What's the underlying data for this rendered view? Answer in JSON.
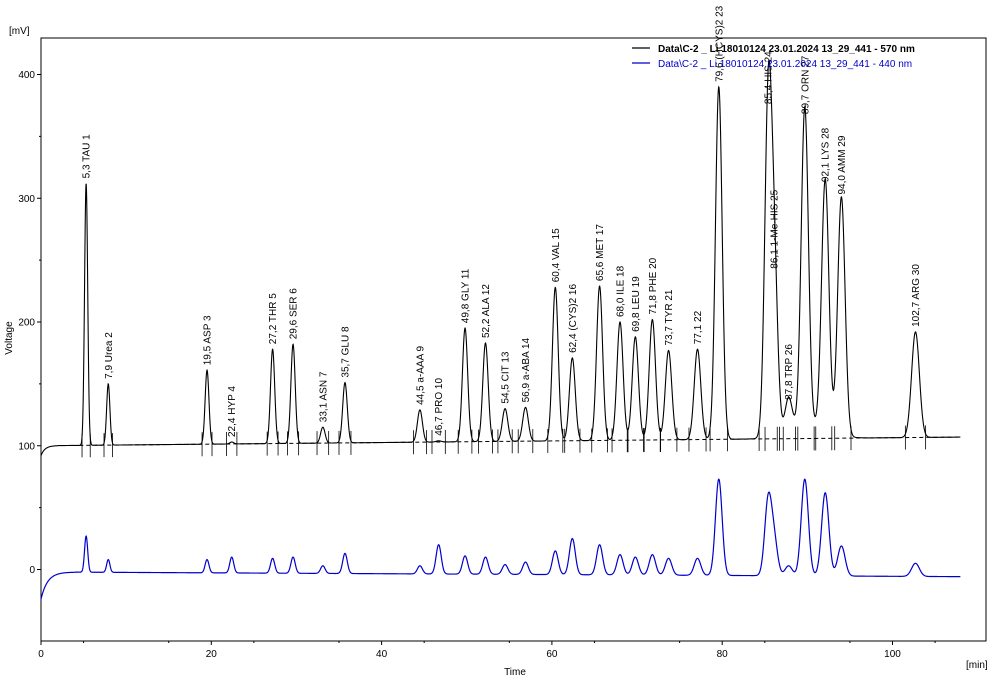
{
  "chart_data": {
    "type": "line",
    "xlabel": "Time",
    "ylabel": "Voltage",
    "x_unit": "[min]",
    "y_unit": "[mV]",
    "xlim": [
      0,
      110
    ],
    "ylim": [
      -58,
      430
    ],
    "x_ticks": [
      0,
      20,
      40,
      60,
      80,
      100
    ],
    "y_ticks": [
      0,
      100,
      200,
      300,
      400
    ],
    "grid": false,
    "legend_position": "top-right",
    "series": [
      {
        "name": "Data\\C-2 _ Li 18010124 23.01.2024 13_29_441 - 570 nm",
        "color": "#000000",
        "baseline": 100,
        "baseline_slope": 0.065
      },
      {
        "name": "Data\\C-2 _ Li 18010124 23.01.2024 13_29_441 - 440 nm",
        "color": "#0000cc",
        "baseline": -2,
        "baseline_slope": -0.035
      }
    ],
    "peaks": [
      {
        "label": "5,3 TAU   1",
        "t": 5.3,
        "h570": 312,
        "h440": 27
      },
      {
        "label": "7,9 Urea   2",
        "t": 7.9,
        "h570": 150,
        "h440": 8
      },
      {
        "label": "19,5 ASP   3",
        "t": 19.5,
        "h570": 161,
        "h440": 8
      },
      {
        "label": "22,4 HYP   4",
        "t": 22.4,
        "h570": 103,
        "h440": 10
      },
      {
        "label": "27,2 THR   5",
        "t": 27.2,
        "h570": 178,
        "h440": 9
      },
      {
        "label": "29,6 SER   6",
        "t": 29.6,
        "h570": 182,
        "h440": 10
      },
      {
        "label": "33,1 ASN   7",
        "t": 33.1,
        "h570": 115,
        "h440": 3
      },
      {
        "label": "35,7 GLU   8",
        "t": 35.7,
        "h570": 151,
        "h440": 13
      },
      {
        "label": "44,5 a-AAA   9",
        "t": 44.5,
        "h570": 129,
        "h440": 3
      },
      {
        "label": "46,7 PRO   10",
        "t": 46.7,
        "h570": 104,
        "h440": 20
      },
      {
        "label": "49,8 GLY   11",
        "t": 49.8,
        "h570": 195,
        "h440": 11
      },
      {
        "label": "52,2 ALA   12",
        "t": 52.2,
        "h570": 183,
        "h440": 10
      },
      {
        "label": "54,5 CIT   13",
        "t": 54.5,
        "h570": 130,
        "h440": 4
      },
      {
        "label": "56,9 a-ABA   14",
        "t": 56.9,
        "h570": 131,
        "h440": 6
      },
      {
        "label": "60,4 VAL   15",
        "t": 60.4,
        "h570": 228,
        "h440": 15
      },
      {
        "label": "62,4 (CYS)2   16",
        "t": 62.4,
        "h570": 171,
        "h440": 25
      },
      {
        "label": "65,6 MET   17",
        "t": 65.6,
        "h570": 229,
        "h440": 20
      },
      {
        "label": "68,0 ILE   18",
        "t": 68.0,
        "h570": 200,
        "h440": 12
      },
      {
        "label": "69,8 LEU   19",
        "t": 69.8,
        "h570": 188,
        "h440": 10
      },
      {
        "label": "71,8 PHE   20",
        "t": 71.8,
        "h570": 202,
        "h440": 12
      },
      {
        "label": "73,7 TYR   21",
        "t": 73.7,
        "h570": 177,
        "h440": 9
      },
      {
        "label": "77,1   22",
        "t": 77.1,
        "h570": 178,
        "h440": 9
      },
      {
        "label": "79,6 (HCYS)2   23",
        "t": 79.6,
        "h570": 390,
        "h440": 73
      },
      {
        "label": "85,4 HIS   24",
        "t": 85.4,
        "h570": 372,
        "h440": 55
      },
      {
        "label": "86,1 1-Me-HIS   25",
        "t": 86.1,
        "h570": 239,
        "h440": 22
      },
      {
        "label": "87,8 TRP   26",
        "t": 87.8,
        "h570": 133,
        "h440": 3
      },
      {
        "label": "89,7 ORN   27",
        "t": 89.7,
        "h570": 364,
        "h440": 73
      },
      {
        "label": "92,1 LYS   28",
        "t": 92.1,
        "h570": 309,
        "h440": 62
      },
      {
        "label": "94,0 AMM   29",
        "t": 94.0,
        "h570": 299,
        "h440": 19
      },
      {
        "label": "102,7 ARG   30",
        "t": 102.7,
        "h570": 192,
        "h440": 5
      }
    ]
  }
}
